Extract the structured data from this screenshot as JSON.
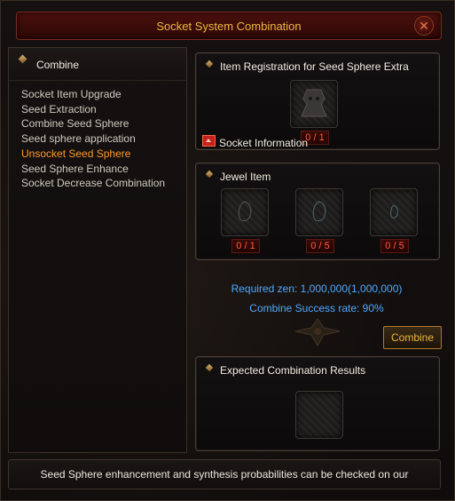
{
  "window": {
    "title": "Socket System Combination",
    "close_icon": "close-x-icon"
  },
  "sidebar": {
    "header": "Combine",
    "items": [
      {
        "label": "Socket Item Upgrade"
      },
      {
        "label": "Seed Extraction"
      },
      {
        "label": "Combine Seed Sphere"
      },
      {
        "label": "Seed sphere application"
      },
      {
        "label": "Unsocket Seed Sphere",
        "active": true
      },
      {
        "label": "Seed Sphere Enhance"
      },
      {
        "label": "Socket Decrease Combination"
      }
    ]
  },
  "registration": {
    "title": "Item Registration for Seed Sphere Extra",
    "count": "0 / 1",
    "socket_info_label": "Socket Information"
  },
  "jewel": {
    "title": "Jewel Item",
    "slots": [
      {
        "count": "0 / 1"
      },
      {
        "count": "0 / 5"
      },
      {
        "count": "0 / 5"
      }
    ]
  },
  "info": {
    "required_zen": "Required zen: 1,000,000(1,000,000)",
    "success_rate": "Combine Success rate: 90%"
  },
  "combine_button": "Combine",
  "results": {
    "title": "Expected Combination Results"
  },
  "footer": {
    "notice": "Seed Sphere enhancement and synthesis probabilities can be checked on our"
  },
  "colors": {
    "title_gold": "#f0b63b",
    "active_orange": "#ff9a2a",
    "info_blue": "#4fa8ff",
    "count_red": "#ff5a3c"
  }
}
